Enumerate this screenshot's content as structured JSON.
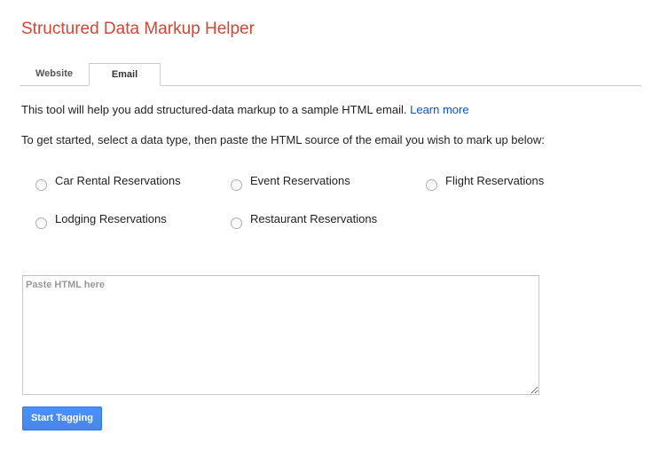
{
  "app": {
    "title": "Structured Data Markup Helper"
  },
  "tabs": [
    {
      "label": "Website",
      "active": false
    },
    {
      "label": "Email",
      "active": true
    }
  ],
  "intro": {
    "text": "This tool will help you add structured-data markup to a sample HTML email.",
    "link_label": "Learn more"
  },
  "instructions": "To get started, select a data type, then paste the HTML source of the email you wish to mark up below:",
  "data_types": [
    {
      "label": "Car Rental Reservations",
      "selected": false
    },
    {
      "label": "Event Reservations",
      "selected": false
    },
    {
      "label": "Flight Reservations",
      "selected": false
    },
    {
      "label": "Lodging Reservations",
      "selected": false
    },
    {
      "label": "Restaurant Reservations",
      "selected": false
    }
  ],
  "html_input": {
    "value": "",
    "placeholder": "Paste HTML here"
  },
  "start_button": {
    "label": "Start Tagging"
  },
  "colors": {
    "title": "#d14836",
    "link": "#1155cc",
    "primary_button": "#4d90fe"
  }
}
